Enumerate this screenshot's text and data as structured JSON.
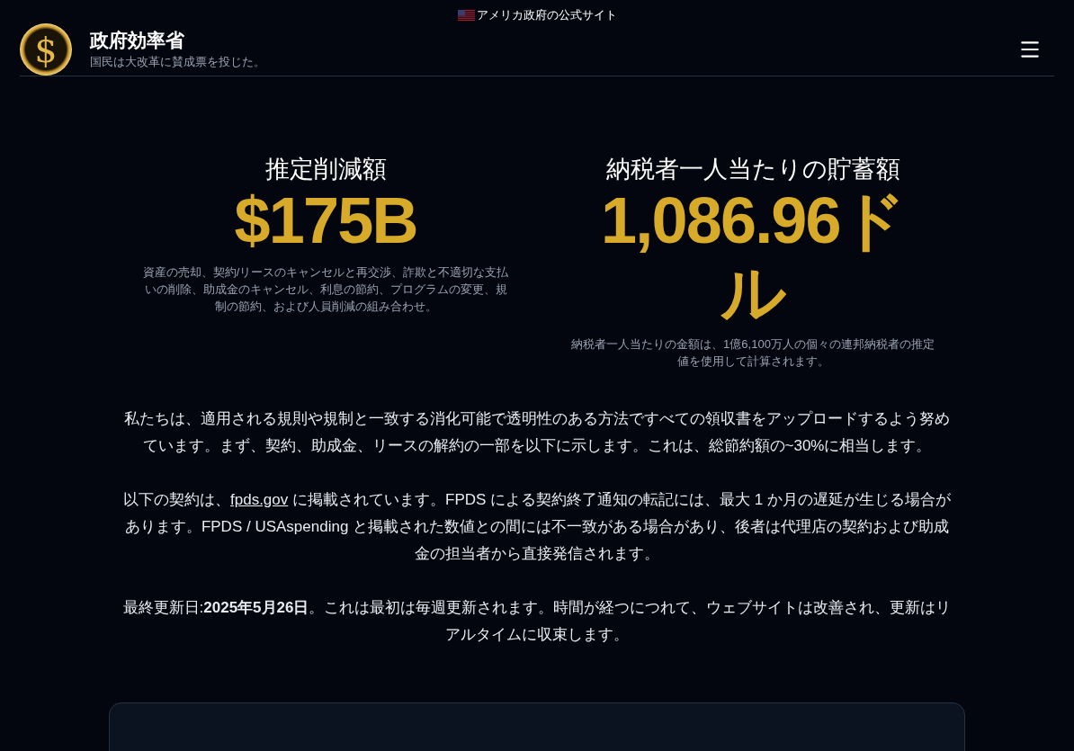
{
  "banner": {
    "text": "アメリカ政府の公式サイト"
  },
  "header": {
    "logo_symbol": "$",
    "title": "政府効率省",
    "subtitle": "国民は大改革に賛成票を投じた。"
  },
  "stats": [
    {
      "label": "推定削減額",
      "value": "$175B",
      "note": "資産の売却、契約/リースのキャンセルと再交渉、詐欺と不適切な支払いの削除、助成金のキャンセル、利息の節約、プログラムの変更、規制の節約、および人員削減の組み合わせ。"
    },
    {
      "label": "納税者一人当たりの貯蓄額",
      "value": "1,086.96ドル",
      "note": "納税者一人当たりの金額は、1億6,100万人の個々の連邦納税者の推定値を使用して計算されます。"
    }
  ],
  "paragraphs": [
    {
      "text": "私たちは、適用される規則や規制と一致する消化可能で透明性のある方法ですべての領収書をアップロードするよう努めています。まず、契約、助成金、リースの解約の一部を以下に示します。これは、総節約額の~30%に相当します。"
    },
    {
      "before": "以下の契約は、",
      "link": "fpds.gov",
      "text": " に掲載されています。FPDS による契約終了通知の転記には、最大 1 か月の遅延が生じる場合があります。FPDS / USAspending と掲載された数値との間には不一致がある場合があり、後者は代理店の契約および助成金の担当者から直接発信されます。"
    },
    {
      "text": "最終更新日:**2025年5月26日**。これは最初は毎週更新されます。時間が経つにつれて、ウェブサイトは改善され、更新はリアルタイムに収束します。"
    }
  ]
}
